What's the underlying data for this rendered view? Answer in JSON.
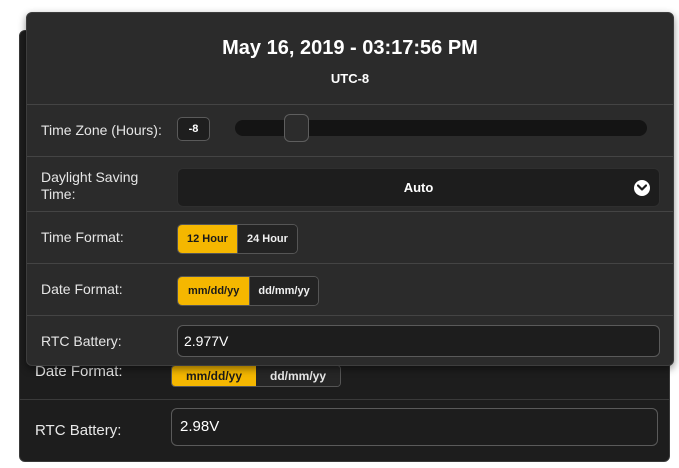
{
  "background_panel": {
    "date_format_label": "Date Format:",
    "date_format_options": [
      "mm/dd/yy",
      "dd/mm/yy"
    ],
    "rtc_battery_label": "RTC Battery:",
    "rtc_battery_value": "2.98V"
  },
  "header": {
    "datetime": "May 16, 2019 - 03:17:56 PM",
    "utc_offset": "UTC-8"
  },
  "time_zone": {
    "label": "Time Zone (Hours):",
    "value": "-8"
  },
  "daylight_saving": {
    "label": "Daylight Saving Time:",
    "selected": "Auto"
  },
  "time_format": {
    "label": "Time Format:",
    "options": [
      "12 Hour",
      "24 Hour"
    ],
    "selected": "12 Hour"
  },
  "date_format": {
    "label": "Date Format:",
    "options": [
      "mm/dd/yy",
      "dd/mm/yy"
    ],
    "selected": "mm/dd/yy"
  },
  "rtc_battery": {
    "label": "RTC Battery:",
    "value": "2.977V"
  },
  "colors": {
    "accent": "#f5b700",
    "panel_bg": "#2b2b2b",
    "input_bg": "#1d1d1d"
  }
}
